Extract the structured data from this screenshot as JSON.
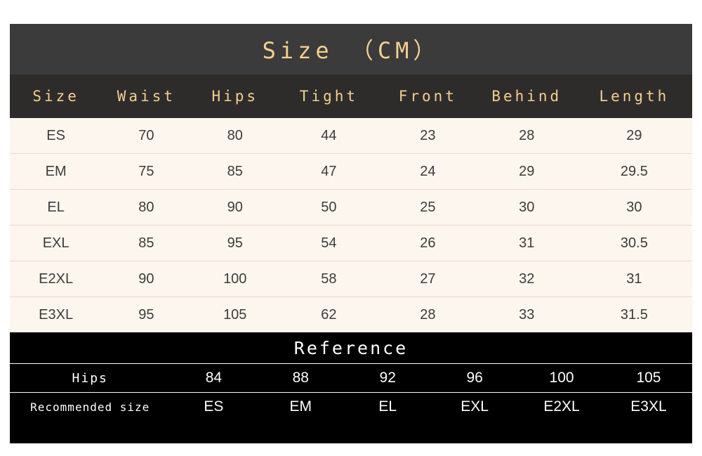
{
  "title": "Size （CM）",
  "table": {
    "headers": [
      "Size",
      "Waist",
      "Hips",
      "Tight",
      "Front",
      "Behind",
      "Length"
    ],
    "rows": [
      [
        "ES",
        "70",
        "80",
        "44",
        "23",
        "28",
        "29"
      ],
      [
        "EM",
        "75",
        "85",
        "47",
        "24",
        "29",
        "29.5"
      ],
      [
        "EL",
        "80",
        "90",
        "50",
        "25",
        "30",
        "30"
      ],
      [
        "EXL",
        "85",
        "95",
        "54",
        "26",
        "31",
        "30.5"
      ],
      [
        "E2XL",
        "90",
        "100",
        "58",
        "27",
        "32",
        "31"
      ],
      [
        "E3XL",
        "95",
        "105",
        "62",
        "28",
        "33",
        "31.5"
      ]
    ]
  },
  "reference": {
    "title": "Reference",
    "hips_label": "Hips",
    "hips_values": [
      "84",
      "88",
      "92",
      "96",
      "100",
      "105"
    ],
    "recommended_label": "Recommended size",
    "recommended_values": [
      "ES",
      "EM",
      "EL",
      "EXL",
      "E2XL",
      "E3XL"
    ]
  },
  "colors": {
    "title_band": "#3b3b3b",
    "header_band": "#2e2c2b",
    "accent_text": "#f3cf8f",
    "body_bg": "#fdf6ee",
    "reference_bg": "#000000"
  }
}
